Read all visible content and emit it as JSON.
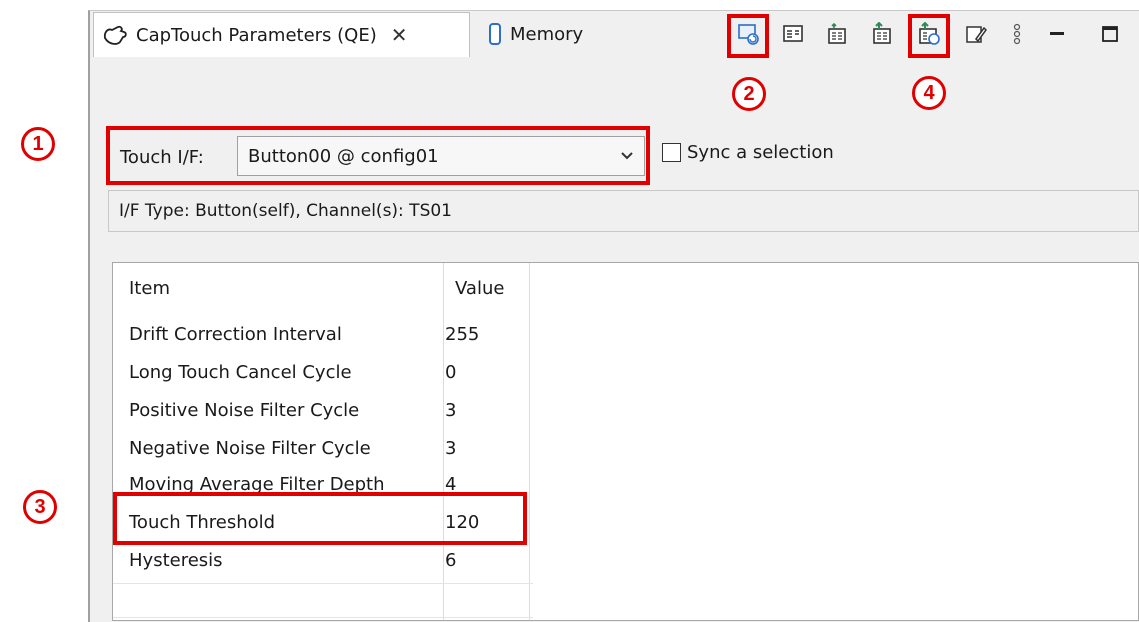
{
  "tabs": [
    {
      "label": "CapTouch Parameters (QE)",
      "icon": "captouch-hand-icon",
      "closable": true
    },
    {
      "label": "Memory",
      "icon": "memory-icon"
    }
  ],
  "toolbar": {
    "buttons": [
      {
        "icon": "monitor-refresh-icon",
        "callout": "2"
      },
      {
        "icon": "view-window-icon"
      },
      {
        "icon": "write-parameters-icon"
      },
      {
        "icon": "write-all-icon"
      },
      {
        "icon": "write-refresh-icon",
        "callout": "4"
      },
      {
        "icon": "edit-pen-icon"
      },
      {
        "icon": "more-vertical-icon"
      },
      {
        "icon": "minimize-icon"
      },
      {
        "icon": "maximize-icon"
      }
    ]
  },
  "callouts": {
    "one": "1",
    "two": "2",
    "three": "3",
    "four": "4"
  },
  "touch_if": {
    "label": "Touch I/F:",
    "value": "Button00 @ config01",
    "sync_label": "Sync a selection",
    "sync_checked": false
  },
  "if_type": "I/F Type: Button(self), Channel(s): TS01",
  "table": {
    "headers": [
      "Item",
      "Value"
    ],
    "rows": [
      {
        "item": "Drift Correction Interval",
        "value": "255"
      },
      {
        "item": "Long Touch Cancel Cycle",
        "value": "0"
      },
      {
        "item": "Positive Noise Filter Cycle",
        "value": "3"
      },
      {
        "item": "Negative Noise Filter Cycle",
        "value": "3"
      },
      {
        "item": "Moving Average Filter Depth",
        "value": "4"
      },
      {
        "item": "Touch Threshold",
        "value": "120"
      },
      {
        "item": "Hysteresis",
        "value": "6"
      }
    ]
  },
  "colors": {
    "highlight": "#e00000",
    "panel": "#f0f0f0",
    "accent_green": "#2e8b57",
    "accent_blue": "#2a6fc9"
  }
}
